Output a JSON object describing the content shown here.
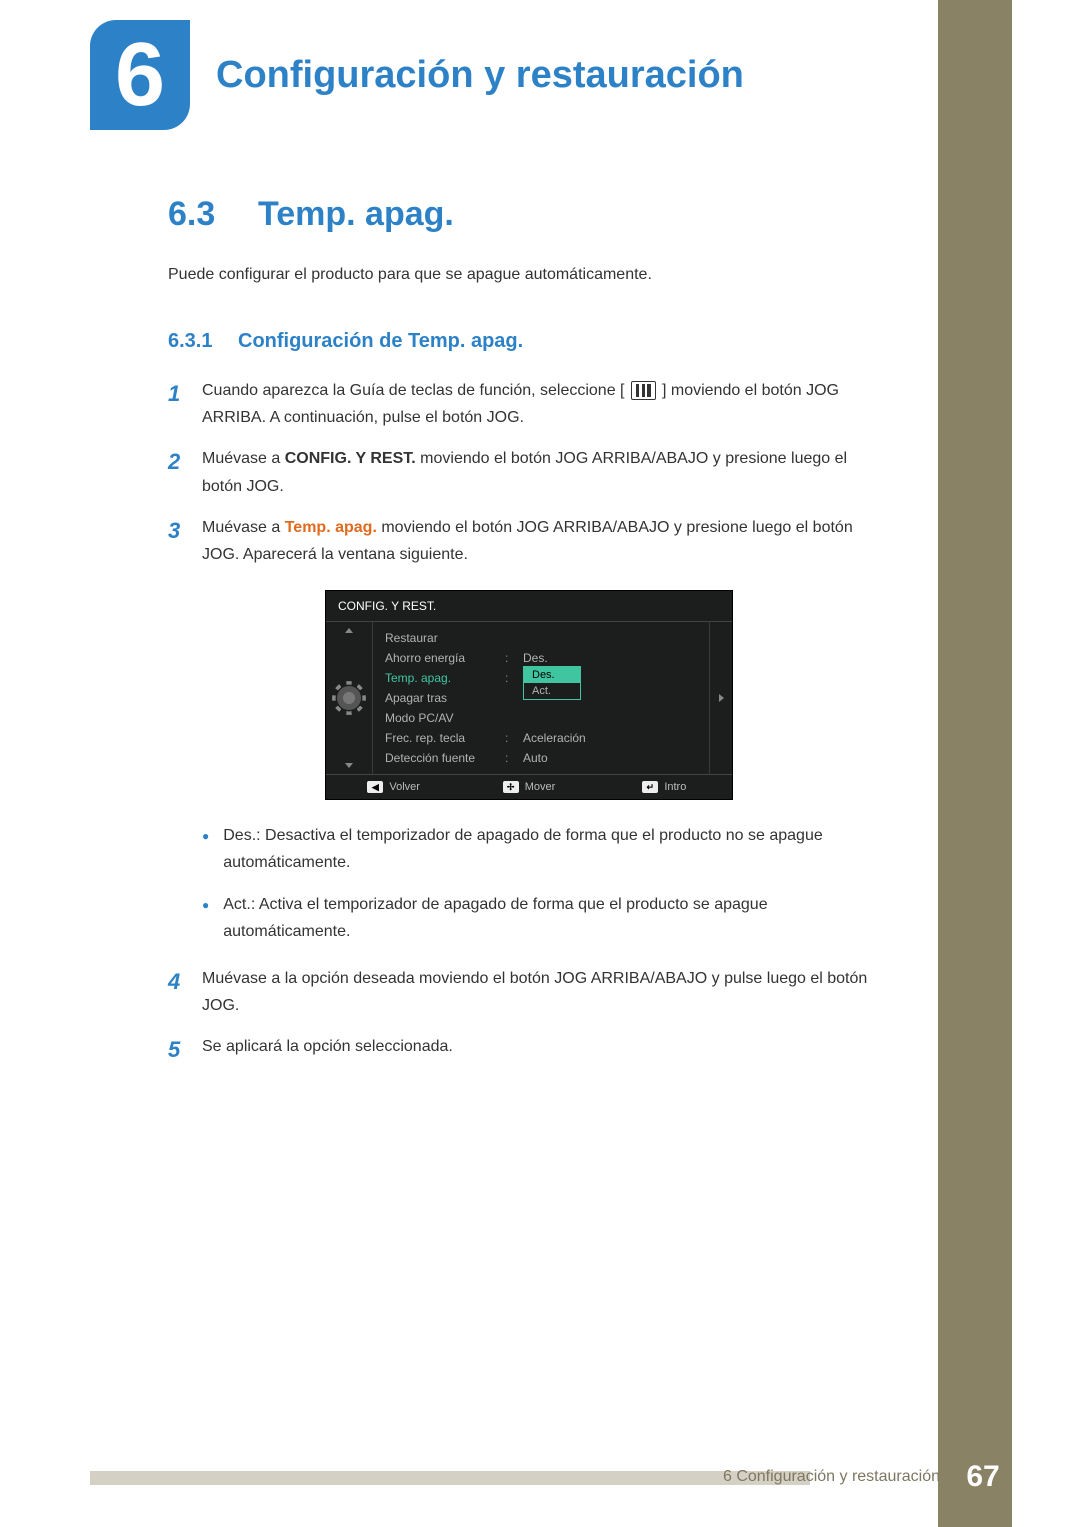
{
  "chapter": {
    "number": "6",
    "title": "Configuración y restauración"
  },
  "section": {
    "number": "6.3",
    "title": "Temp. apag.",
    "intro": "Puede configurar el producto para que se apague automáticamente."
  },
  "subsection": {
    "number": "6.3.1",
    "title": "Configuración de Temp. apag."
  },
  "steps": {
    "s1_a": "Cuando aparezca la Guía de teclas de función, seleccione [",
    "s1_b": "] moviendo el botón JOG ARRIBA. A continuación, pulse el botón JOG.",
    "s2_a": "Muévase a ",
    "s2_bold": "CONFIG. Y REST.",
    "s2_b": " moviendo el botón JOG ARRIBA/ABAJO y presione luego el botón JOG.",
    "s3_a": "Muévase a ",
    "s3_bold": "Temp. apag.",
    "s3_b": " moviendo el botón JOG ARRIBA/ABAJO y presione luego el botón JOG. Aparecerá la ventana siguiente.",
    "s4": "Muévase a la opción deseada moviendo el botón JOG ARRIBA/ABAJO y pulse luego el botón JOG.",
    "s5": "Se aplicará la opción seleccionada.",
    "n1": "1",
    "n2": "2",
    "n3": "3",
    "n4": "4",
    "n5": "5"
  },
  "osd": {
    "title": "CONFIG. Y REST.",
    "items": [
      {
        "label": "Restaurar",
        "value": ""
      },
      {
        "label": "Ahorro energía",
        "value": "Des."
      },
      {
        "label": "Temp. apag.",
        "value": "Des."
      },
      {
        "label": "Apagar tras",
        "value": ""
      },
      {
        "label": "Modo PC/AV",
        "value": ""
      },
      {
        "label": "Frec. rep. tecla",
        "value": "Aceleración"
      },
      {
        "label": "Detección fuente",
        "value": "Auto"
      }
    ],
    "dropdown": {
      "selected": "Des.",
      "other": "Act."
    },
    "footer": {
      "back": "Volver",
      "move": "Mover",
      "enter": "Intro",
      "back_icon": "◀",
      "move_icon": "✢",
      "enter_icon": "↵"
    }
  },
  "bullets": {
    "b1_bold": "Des.",
    "b1_text": ": Desactiva el temporizador de apagado de forma que el producto no se apague automáticamente.",
    "b2_bold": "Act.",
    "b2_text": ": Activa el temporizador de apagado de forma que el producto se apague automáticamente."
  },
  "footer": {
    "label": "6 Configuración y restauración",
    "page": "67"
  }
}
